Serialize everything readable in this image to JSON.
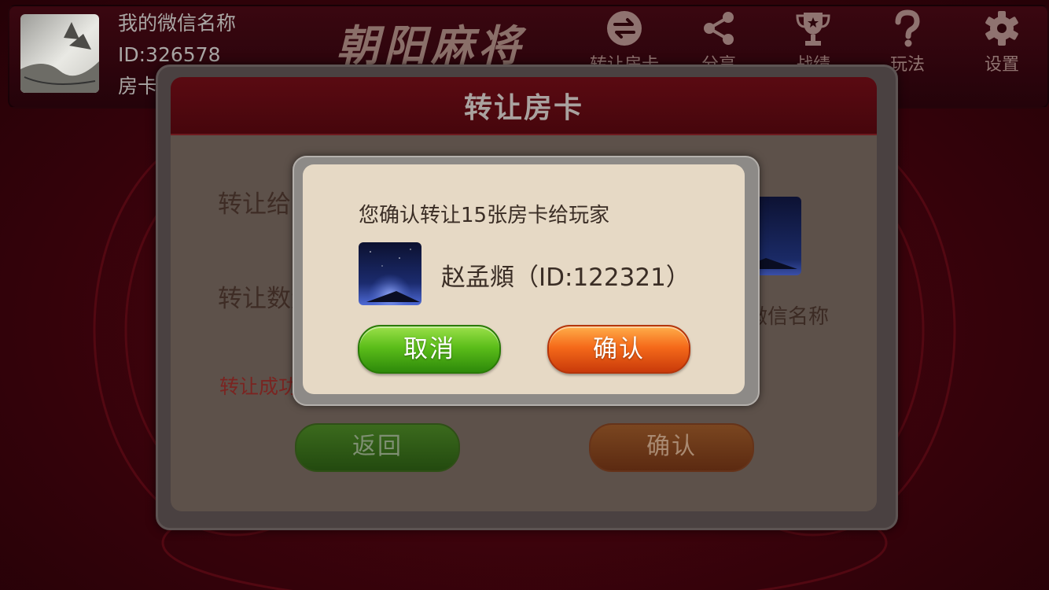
{
  "header": {
    "nickname": "我的微信名称",
    "user_id": "ID:326578",
    "room_card_partial": "房卡：",
    "game_title": "朝阳麻将",
    "nav": [
      {
        "label": "转让房卡",
        "icon": "transfer-icon"
      },
      {
        "label": "分享",
        "icon": "share-icon"
      },
      {
        "label": "战绩",
        "icon": "trophy-icon"
      },
      {
        "label": "玩法",
        "icon": "question-icon"
      },
      {
        "label": "设置",
        "icon": "gear-icon"
      }
    ]
  },
  "transfer_dialog": {
    "title": "转让房卡",
    "transfer_to_label": "转让给",
    "quantity_label": "转让数量",
    "success_hint_partial": "转让成功",
    "receiver_name": "收卡人微信名称",
    "back_button": "返回",
    "confirm_button": "确认"
  },
  "confirm_popup": {
    "message": "您确认转让15张房卡给玩家",
    "player_name": "赵孟頫（ID:122321）",
    "cancel_button": "取消",
    "ok_button": "确认"
  },
  "colors": {
    "background": "#3d030c",
    "popup_bg": "#e6d9c5",
    "cancel_green": "#5cbe1a",
    "ok_orange": "#f56a1a"
  }
}
